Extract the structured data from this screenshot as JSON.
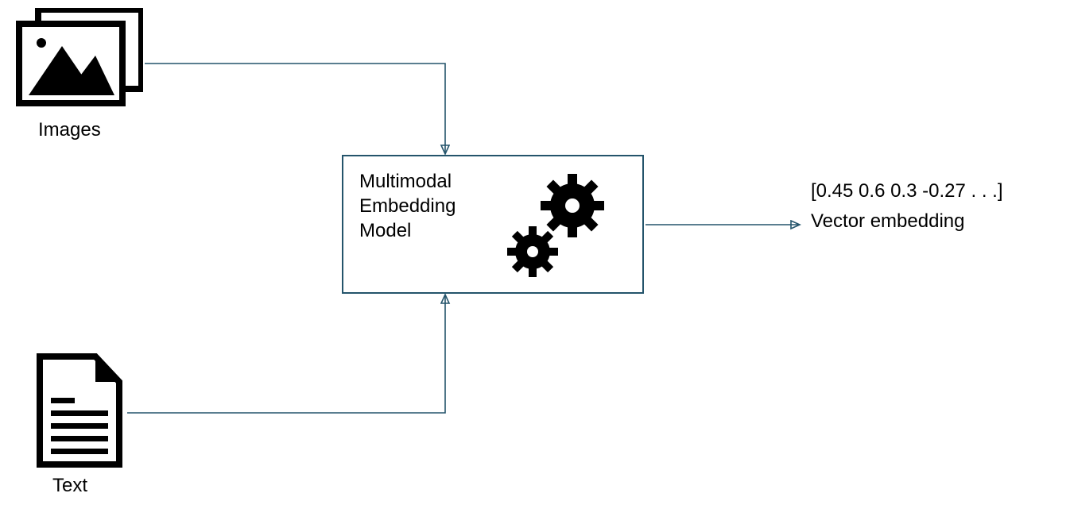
{
  "inputs": {
    "images_label": "Images",
    "text_label": "Text"
  },
  "model": {
    "line1": "Multimodal",
    "line2": "Embedding",
    "line3": "Model"
  },
  "output": {
    "vector_display": "[0.45 0.6 0.3 -0.27 . . .]",
    "caption": "Vector embedding"
  },
  "colors": {
    "line": "#24546b",
    "icon": "#000000"
  }
}
